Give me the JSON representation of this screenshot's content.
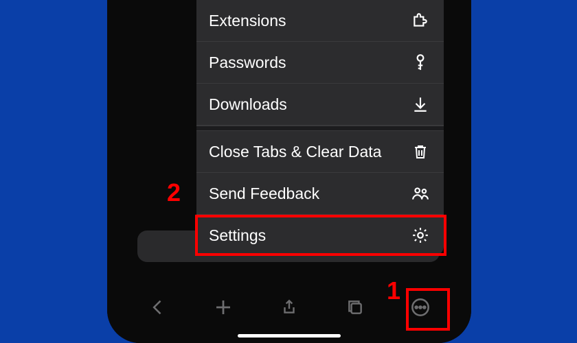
{
  "menu": {
    "group1": [
      {
        "label": "Extensions",
        "icon": "puzzle-icon"
      },
      {
        "label": "Passwords",
        "icon": "key-icon"
      },
      {
        "label": "Downloads",
        "icon": "download-icon"
      }
    ],
    "group2": [
      {
        "label": "Close Tabs & Clear Data",
        "icon": "trash-icon"
      },
      {
        "label": "Send Feedback",
        "icon": "people-icon"
      },
      {
        "label": "Settings",
        "icon": "gear-icon"
      }
    ]
  },
  "annotations": {
    "step1": "1",
    "step2": "2"
  }
}
